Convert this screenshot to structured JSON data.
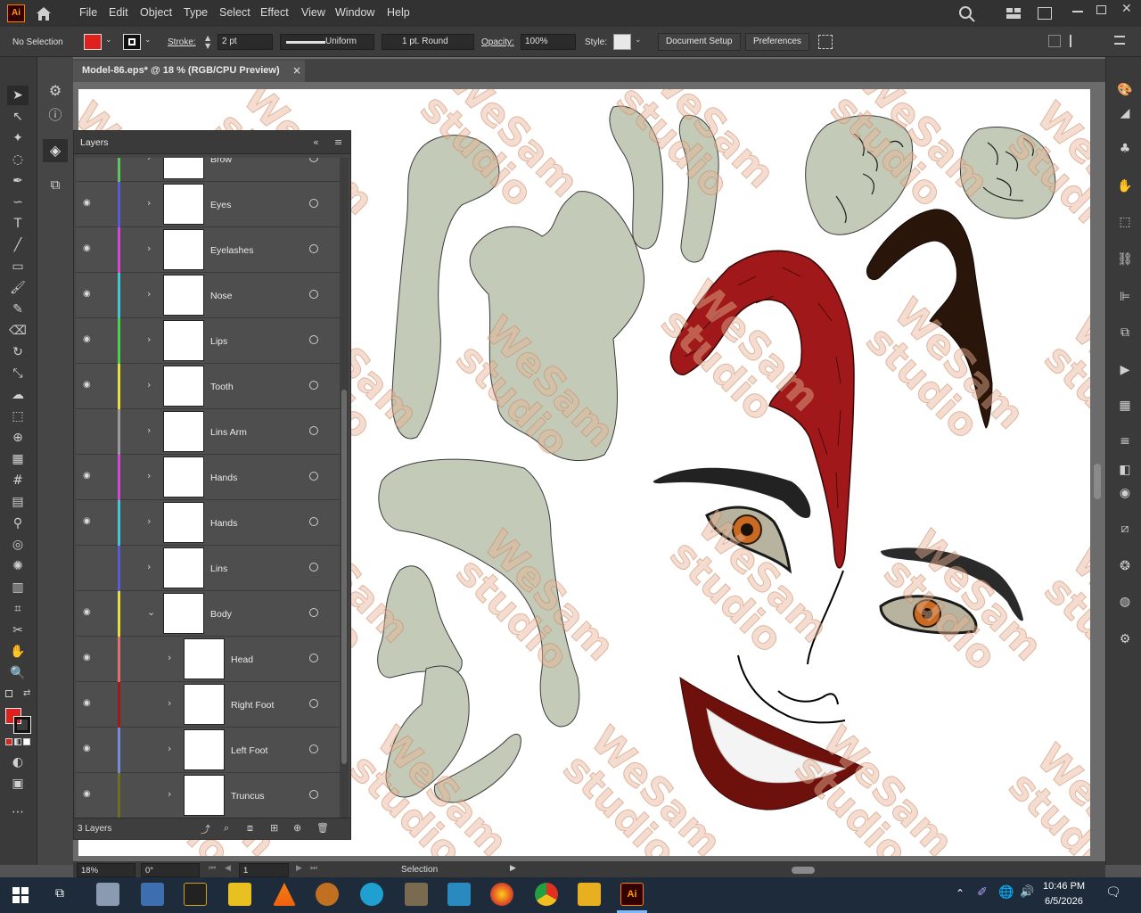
{
  "app": {
    "logo": "Ai",
    "icon": "illustrator-app-icon"
  },
  "menu": [
    "File",
    "Edit",
    "Object",
    "Type",
    "Select",
    "Effect",
    "View",
    "Window",
    "Help"
  ],
  "control": {
    "selection_status": "No Selection",
    "fill_color": "#e0201c",
    "stroke_label": "Stroke:",
    "stroke_weight": "2 pt",
    "stroke_profile": "Uniform",
    "brush": "1 pt. Round",
    "opacity_label": "Opacity:",
    "opacity_value": "100%",
    "style_label": "Style:",
    "document_setup": "Document Setup",
    "preferences": "Preferences"
  },
  "document": {
    "tab_title": "Model-86.eps* @ 18 % (RGB/CPU Preview)",
    "close": "×"
  },
  "layers_panel": {
    "title": "Layers",
    "footer": "3 Layers",
    "rows": [
      {
        "name": "Brow",
        "visible": false,
        "color": "#5cc85c",
        "indent": 0,
        "expanded": false
      },
      {
        "name": "Eyes",
        "visible": true,
        "color": "#5a5ad8",
        "indent": 0,
        "expanded": false
      },
      {
        "name": "Eyelashes",
        "visible": true,
        "color": "#d846d8",
        "indent": 0,
        "expanded": false
      },
      {
        "name": "Nose",
        "visible": true,
        "color": "#40c8d8",
        "indent": 0,
        "expanded": false
      },
      {
        "name": "Lips",
        "visible": true,
        "color": "#4ad24a",
        "indent": 0,
        "expanded": false
      },
      {
        "name": "Tooth",
        "visible": true,
        "color": "#e8e040",
        "indent": 0,
        "expanded": false
      },
      {
        "name": "Lins Arm",
        "visible": false,
        "color": "#9a9a9a",
        "indent": 0,
        "expanded": false
      },
      {
        "name": "Hands",
        "visible": true,
        "color": "#d846d8",
        "indent": 0,
        "expanded": false
      },
      {
        "name": "Hands",
        "visible": true,
        "color": "#40c8d8",
        "indent": 0,
        "expanded": false
      },
      {
        "name": "Lins",
        "visible": false,
        "color": "#5a5ad8",
        "indent": 0,
        "expanded": false
      },
      {
        "name": "Body",
        "visible": true,
        "color": "#e8e040",
        "indent": 0,
        "expanded": true
      },
      {
        "name": "Head",
        "visible": true,
        "color": "#e07070",
        "indent": 1,
        "expanded": false
      },
      {
        "name": "Right Foot",
        "visible": true,
        "color": "#a01818",
        "indent": 1,
        "expanded": false
      },
      {
        "name": "Left Foot",
        "visible": true,
        "color": "#7a8ad8",
        "indent": 1,
        "expanded": false
      },
      {
        "name": "Truncus",
        "visible": true,
        "color": "#6a7020",
        "indent": 1,
        "expanded": false
      }
    ]
  },
  "status": {
    "zoom": "18%",
    "rotation": "0°",
    "artboard": "1",
    "tool": "Selection"
  },
  "taskbar": {
    "time": "10:46 PM",
    "date": "6/5/2026"
  },
  "watermark": {
    "line1": "WeSam",
    "line2": "studio"
  }
}
